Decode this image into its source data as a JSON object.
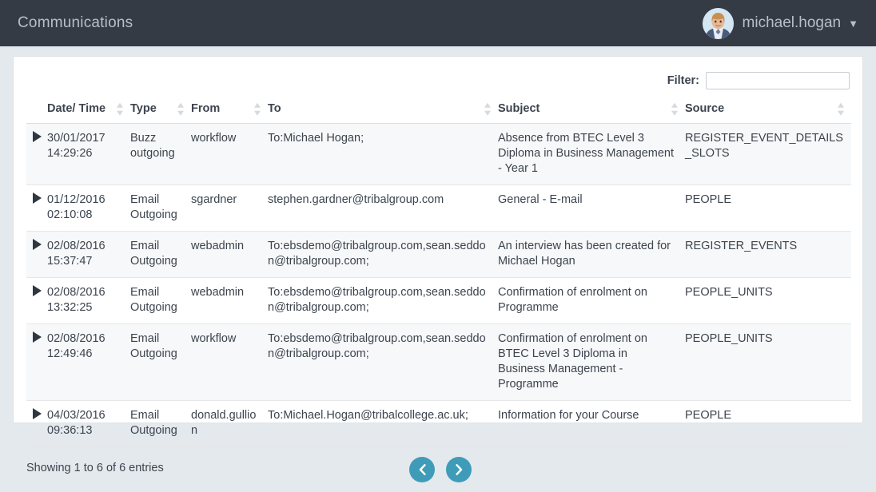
{
  "header": {
    "app_title": "Communications",
    "user_name": "michael.hogan",
    "caret": "▼",
    "avatar_icon": "user-avatar-photo"
  },
  "filter": {
    "label": "Filter:",
    "value": "",
    "placeholder": ""
  },
  "table": {
    "columns": [
      {
        "key": "date",
        "label": "Date/ Time",
        "sortable": true
      },
      {
        "key": "type",
        "label": "Type",
        "sortable": true
      },
      {
        "key": "from",
        "label": "From",
        "sortable": true
      },
      {
        "key": "to",
        "label": "To",
        "sortable": true
      },
      {
        "key": "subject",
        "label": "Subject",
        "sortable": true
      },
      {
        "key": "source",
        "label": "Source",
        "sortable": true
      }
    ],
    "rows": [
      {
        "date": "30/01/2017 14:29:26",
        "type": "Buzz outgoing",
        "from": "workflow",
        "to": "To:Michael Hogan;",
        "subject": "Absence from BTEC Level 3 Diploma in Business Management - Year 1",
        "source": "REGISTER_EVENT_DETAILS_SLOTS"
      },
      {
        "date": "01/12/2016 02:10:08",
        "type": "Email Outgoing",
        "from": "sgardner",
        "to": "stephen.gardner@tribalgroup.com",
        "subject": "General - E-mail",
        "source": "PEOPLE"
      },
      {
        "date": "02/08/2016 15:37:47",
        "type": "Email Outgoing",
        "from": "webadmin",
        "to": "To:ebsdemo@tribalgroup.com,sean.seddon@tribalgroup.com;",
        "subject": "An interview has been created for Michael Hogan",
        "source": "REGISTER_EVENTS"
      },
      {
        "date": "02/08/2016 13:32:25",
        "type": "Email Outgoing",
        "from": "webadmin",
        "to": "To:ebsdemo@tribalgroup.com,sean.seddon@tribalgroup.com;",
        "subject": "Confirmation of enrolment on Programme",
        "source": "PEOPLE_UNITS"
      },
      {
        "date": "02/08/2016 12:49:46",
        "type": "Email Outgoing",
        "from": "workflow",
        "to": "To:ebsdemo@tribalgroup.com,sean.seddon@tribalgroup.com;",
        "subject": "Confirmation of enrolment on BTEC Level 3 Diploma in Business Management - Programme",
        "source": "PEOPLE_UNITS"
      },
      {
        "date": "04/03/2016 09:36:13",
        "type": "Email Outgoing",
        "from": "donald.gullion",
        "to": "To:Michael.Hogan@tribalcollege.ac.uk;",
        "subject": "Information for your Course",
        "source": "PEOPLE"
      }
    ]
  },
  "footer": {
    "showing": "Showing 1 to 6 of 6 entries",
    "prev_label": "‹",
    "next_label": "›"
  },
  "colors": {
    "topbar": "#343b44",
    "page_bg": "#e4e9ed",
    "panel": "#ffffff",
    "pager": "#3f9cb9",
    "text": "#3c444e",
    "row_alt": "#f7f8f9"
  }
}
